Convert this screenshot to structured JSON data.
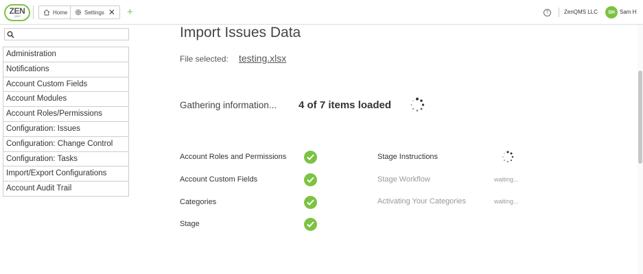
{
  "header": {
    "logo_text": "ZEN",
    "logo_sub": "QMS",
    "tabs": [
      {
        "label": "Home",
        "icon": "home-icon"
      },
      {
        "label": "Settings",
        "icon": "gear-icon",
        "close": "✕"
      }
    ],
    "add_tab": "+",
    "help": "?",
    "company": "ZenQMS LLC",
    "avatar_initials": "SH",
    "user_name": "Sam H"
  },
  "sidebar": {
    "search_placeholder": "",
    "items": [
      {
        "label": "Administration"
      },
      {
        "label": "Notifications"
      },
      {
        "label": "Account Custom Fields"
      },
      {
        "label": "Account Modules"
      },
      {
        "label": "Account Roles/Permissions"
      },
      {
        "label": "Configuration: Issues"
      },
      {
        "label": "Configuration: Change Control"
      },
      {
        "label": "Configuration: Tasks"
      },
      {
        "label": "Import/Export Configurations"
      },
      {
        "label": "Account Audit Trail"
      }
    ]
  },
  "main": {
    "title": "Import Issues Data",
    "file_label": "File selected:",
    "file_name": "testing.xlsx",
    "gathering": "Gathering information...",
    "progress": "4 of 7 items loaded",
    "steps_left": [
      {
        "label": "Account Roles and Permissions",
        "status": "done"
      },
      {
        "label": "Account Custom Fields",
        "status": "done"
      },
      {
        "label": "Categories",
        "status": "done"
      },
      {
        "label": "Stage",
        "status": "done"
      }
    ],
    "steps_right": [
      {
        "label": "Stage Instructions",
        "status": "loading"
      },
      {
        "label": "Stage Workflow",
        "status": "waiting",
        "status_text": "waiting..."
      },
      {
        "label": "Activating Your Categories",
        "status": "waiting",
        "status_text": "waiting..."
      }
    ]
  },
  "colors": {
    "accent": "#7cc243",
    "muted_text": "#999999"
  }
}
